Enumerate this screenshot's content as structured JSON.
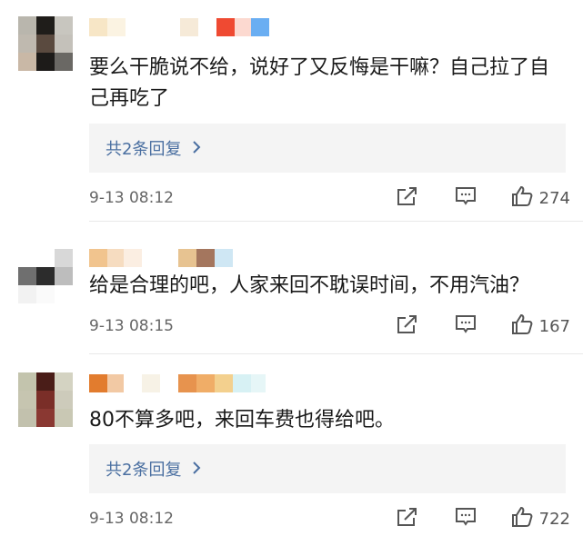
{
  "comments": [
    {
      "text": "要么干脆说不给，说好了又反悔是干嘛？自己拉了自己再吃了",
      "reply_label": "共2条回复",
      "time": "9-13 08:12",
      "likes": "274"
    },
    {
      "text": "给是合理的吧，人家来回不耽误时间，不用汽油？",
      "time": "9-13 08:15",
      "likes": "167"
    },
    {
      "text": "80不算多吧，来回车费也得给吧。",
      "reply_label": "共2条回复",
      "time": "9-13 08:12",
      "likes": "722"
    }
  ],
  "icons": {
    "forward": "forward-icon",
    "comment": "comment-icon",
    "like": "like-icon",
    "chevron": "chevron-right-icon"
  },
  "colors": {
    "link": "#4a6fa1",
    "reply_bg": "#f4f4f4",
    "meta": "#666666"
  }
}
